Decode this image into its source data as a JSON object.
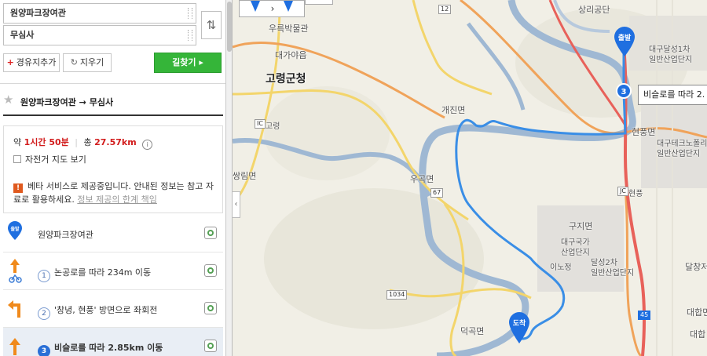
{
  "inputs": {
    "origin_value": "원양파크장여관",
    "destination_value": "무심사"
  },
  "buttons": {
    "add_waypoint": "경유지추가",
    "clear": "지우기",
    "find_route": "길찾기 ▸",
    "swap_icon": "⇅"
  },
  "summary": {
    "title": "원양파크장여관 → 무심사",
    "time_prefix": "약",
    "time_value": "1시간 50분",
    "distance_prefix": "총",
    "distance_value": "27.57km",
    "info_icon": "i",
    "bike_map_label": "자전거 지도 보기",
    "beta_text": "베타 서비스로 제공중입니다. 안내된 정보는 참고 자료로 활용하세요.",
    "beta_link": "정보 제공의 한계 책임"
  },
  "steps": [
    {
      "label": "원양파크장여관",
      "badge": "출발"
    },
    {
      "num": "1",
      "label": "논공로를 따라 234m 이동"
    },
    {
      "num": "2",
      "label": "'창녕, 현풍' 방면으로 좌회전"
    },
    {
      "num": "3",
      "label": "비슬로를 따라 2.85km 이동"
    }
  ],
  "map": {
    "origin_badge": "출발",
    "dest_badge": "도착",
    "waypoint_num": "3",
    "tooltip": "비슬로를 따라 2.",
    "labels": {
      "goryeong": "고령군청",
      "daegaya": "대가야읍",
      "ureuk": "우륵박물관",
      "gaejin": "개진면",
      "ugok": "우곡면",
      "ssangnim": "쌍림면",
      "guji": "구지면",
      "dalseong1": "대구달성1차",
      "dalseong1b": "일반산업단지",
      "hyeonpung": "현풍면",
      "techno1": "대구테크노폴리스",
      "techno2": "일반산업단지",
      "natl1": "대구국가",
      "natl2": "산업단지",
      "dalseong2a": "달성2차",
      "dalseong2b": "일반산업단지",
      "inogang": "이노정",
      "deokgok": "덕곡면",
      "sangni": "상리공단",
      "goryeongic": "고령",
      "hyeonpungjc": "현풍",
      "dalchang": "달창저",
      "daehap": "대합면",
      "daehap2": "대합"
    },
    "shields": {
      "r12": "12",
      "r45": "45",
      "r67": "67",
      "r1034": "1034",
      "ic": "IC",
      "jc": "JC"
    },
    "colors": {
      "river": "#9fb8d3",
      "route": "#3a8ee6",
      "road_yellow": "#f3d56b",
      "road_orange": "#f0a35a",
      "pin": "#1f6fe0",
      "land": "#f1efe6"
    }
  }
}
